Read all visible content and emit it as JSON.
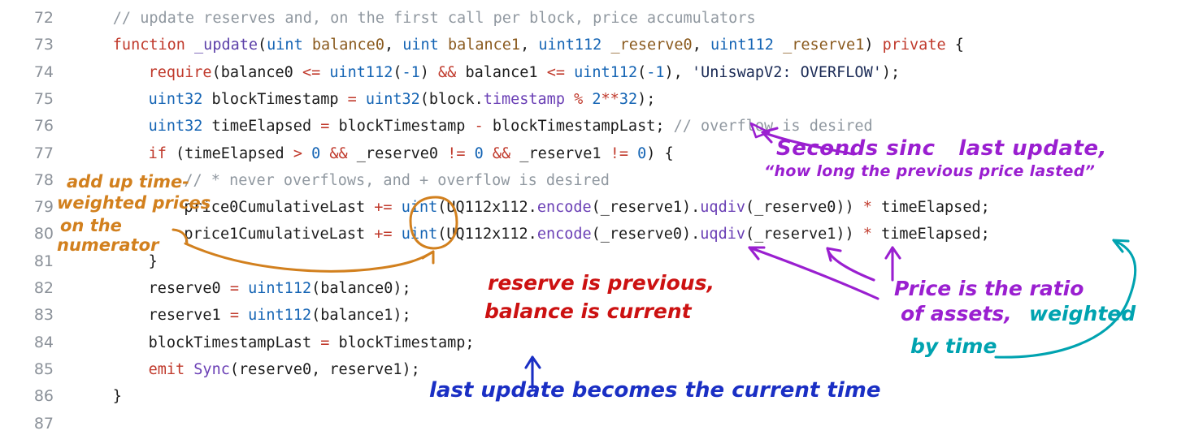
{
  "document": {
    "kind": "source-code-screenshot-with-handwritten-annotations",
    "language": "Solidity",
    "font_size_px": 18.5
  },
  "colors": {
    "background": "#ffffff",
    "line_number": "#8b9199",
    "comment": "#9098a0",
    "keyword": "#c0392b",
    "function_name": "#5b3fa8",
    "type": "#1464b4",
    "parameter": "#8a5a1e",
    "number": "#1464b4",
    "operator": "#c0392b",
    "string": "#1a2a55",
    "method": "#6a3fb5",
    "ink_purple": "#9a1fd0",
    "ink_orange": "#d2801e",
    "ink_red": "#cc1111",
    "ink_blue": "#1a2fc4",
    "ink_teal": "#00a3b0"
  },
  "code": {
    "first_line_number": 72,
    "lines": [
      {
        "n": "72",
        "indent": 4,
        "tokens": [
          {
            "t": "// update reserves and, on the first call per block, price accumulators",
            "c": "c-com"
          }
        ]
      },
      {
        "n": "73",
        "indent": 4,
        "tokens": [
          {
            "t": "function ",
            "c": "c-kw"
          },
          {
            "t": "_update",
            "c": "c-fn"
          },
          {
            "t": "(",
            "c": "c-plain"
          },
          {
            "t": "uint",
            "c": "c-type"
          },
          {
            "t": " ",
            "c": "c-plain"
          },
          {
            "t": "balance0",
            "c": "c-param"
          },
          {
            "t": ", ",
            "c": "c-plain"
          },
          {
            "t": "uint",
            "c": "c-type"
          },
          {
            "t": " ",
            "c": "c-plain"
          },
          {
            "t": "balance1",
            "c": "c-param"
          },
          {
            "t": ", ",
            "c": "c-plain"
          },
          {
            "t": "uint112",
            "c": "c-type"
          },
          {
            "t": " ",
            "c": "c-plain"
          },
          {
            "t": "_reserve0",
            "c": "c-param"
          },
          {
            "t": ", ",
            "c": "c-plain"
          },
          {
            "t": "uint112",
            "c": "c-type"
          },
          {
            "t": " ",
            "c": "c-plain"
          },
          {
            "t": "_reserve1",
            "c": "c-param"
          },
          {
            "t": ") ",
            "c": "c-plain"
          },
          {
            "t": "private",
            "c": "c-kw"
          },
          {
            "t": " {",
            "c": "c-plain"
          }
        ]
      },
      {
        "n": "74",
        "indent": 8,
        "tokens": [
          {
            "t": "require",
            "c": "c-kw"
          },
          {
            "t": "(balance0 ",
            "c": "c-plain"
          },
          {
            "t": "<=",
            "c": "c-op"
          },
          {
            "t": " ",
            "c": "c-plain"
          },
          {
            "t": "uint112",
            "c": "c-type"
          },
          {
            "t": "(",
            "c": "c-plain"
          },
          {
            "t": "-1",
            "c": "c-num"
          },
          {
            "t": ") ",
            "c": "c-plain"
          },
          {
            "t": "&&",
            "c": "c-op"
          },
          {
            "t": " balance1 ",
            "c": "c-plain"
          },
          {
            "t": "<=",
            "c": "c-op"
          },
          {
            "t": " ",
            "c": "c-plain"
          },
          {
            "t": "uint112",
            "c": "c-type"
          },
          {
            "t": "(",
            "c": "c-plain"
          },
          {
            "t": "-1",
            "c": "c-num"
          },
          {
            "t": "), ",
            "c": "c-plain"
          },
          {
            "t": "'UniswapV2: OVERFLOW'",
            "c": "c-str"
          },
          {
            "t": ");",
            "c": "c-plain"
          }
        ]
      },
      {
        "n": "75",
        "indent": 8,
        "tokens": [
          {
            "t": "uint32",
            "c": "c-type"
          },
          {
            "t": " blockTimestamp ",
            "c": "c-plain"
          },
          {
            "t": "=",
            "c": "c-op"
          },
          {
            "t": " ",
            "c": "c-plain"
          },
          {
            "t": "uint32",
            "c": "c-type"
          },
          {
            "t": "(block.",
            "c": "c-plain"
          },
          {
            "t": "timestamp",
            "c": "c-meth"
          },
          {
            "t": " ",
            "c": "c-plain"
          },
          {
            "t": "%",
            "c": "c-op"
          },
          {
            "t": " ",
            "c": "c-plain"
          },
          {
            "t": "2",
            "c": "c-num"
          },
          {
            "t": "**",
            "c": "c-op"
          },
          {
            "t": "32",
            "c": "c-num"
          },
          {
            "t": ");",
            "c": "c-plain"
          }
        ]
      },
      {
        "n": "76",
        "indent": 8,
        "tokens": [
          {
            "t": "uint32",
            "c": "c-type"
          },
          {
            "t": " timeElapsed ",
            "c": "c-plain"
          },
          {
            "t": "=",
            "c": "c-op"
          },
          {
            "t": " blockTimestamp ",
            "c": "c-plain"
          },
          {
            "t": "-",
            "c": "c-op"
          },
          {
            "t": " blockTimestampLast; ",
            "c": "c-plain"
          },
          {
            "t": "// overflow is desired",
            "c": "c-com"
          }
        ]
      },
      {
        "n": "77",
        "indent": 8,
        "tokens": [
          {
            "t": "if",
            "c": "c-kw"
          },
          {
            "t": " (timeElapsed ",
            "c": "c-plain"
          },
          {
            "t": ">",
            "c": "c-op"
          },
          {
            "t": " ",
            "c": "c-plain"
          },
          {
            "t": "0",
            "c": "c-num"
          },
          {
            "t": " ",
            "c": "c-plain"
          },
          {
            "t": "&&",
            "c": "c-op"
          },
          {
            "t": " _reserve0 ",
            "c": "c-plain"
          },
          {
            "t": "!=",
            "c": "c-op"
          },
          {
            "t": " ",
            "c": "c-plain"
          },
          {
            "t": "0",
            "c": "c-num"
          },
          {
            "t": " ",
            "c": "c-plain"
          },
          {
            "t": "&&",
            "c": "c-op"
          },
          {
            "t": " _reserve1 ",
            "c": "c-plain"
          },
          {
            "t": "!=",
            "c": "c-op"
          },
          {
            "t": " ",
            "c": "c-plain"
          },
          {
            "t": "0",
            "c": "c-num"
          },
          {
            "t": ") {",
            "c": "c-plain"
          }
        ]
      },
      {
        "n": "78",
        "indent": 12,
        "tokens": [
          {
            "t": "// * never overflows, and + overflow is desired",
            "c": "c-com"
          }
        ]
      },
      {
        "n": "79",
        "indent": 12,
        "tokens": [
          {
            "t": "price0CumulativeLast ",
            "c": "c-plain"
          },
          {
            "t": "+=",
            "c": "c-op"
          },
          {
            "t": " ",
            "c": "c-plain"
          },
          {
            "t": "uint",
            "c": "c-type"
          },
          {
            "t": "(UQ112x112.",
            "c": "c-plain"
          },
          {
            "t": "encode",
            "c": "c-meth"
          },
          {
            "t": "(_reserve1).",
            "c": "c-plain"
          },
          {
            "t": "uqdiv",
            "c": "c-meth"
          },
          {
            "t": "(_reserve0)) ",
            "c": "c-plain"
          },
          {
            "t": "*",
            "c": "c-op"
          },
          {
            "t": " timeElapsed;",
            "c": "c-plain"
          }
        ]
      },
      {
        "n": "80",
        "indent": 12,
        "tokens": [
          {
            "t": "price1CumulativeLast ",
            "c": "c-plain"
          },
          {
            "t": "+=",
            "c": "c-op"
          },
          {
            "t": " ",
            "c": "c-plain"
          },
          {
            "t": "uint",
            "c": "c-type"
          },
          {
            "t": "(UQ112x112.",
            "c": "c-plain"
          },
          {
            "t": "encode",
            "c": "c-meth"
          },
          {
            "t": "(_reserve0).",
            "c": "c-plain"
          },
          {
            "t": "uqdiv",
            "c": "c-meth"
          },
          {
            "t": "(_reserve1)) ",
            "c": "c-plain"
          },
          {
            "t": "*",
            "c": "c-op"
          },
          {
            "t": " timeElapsed;",
            "c": "c-plain"
          }
        ]
      },
      {
        "n": "81",
        "indent": 8,
        "tokens": [
          {
            "t": "}",
            "c": "c-plain"
          }
        ]
      },
      {
        "n": "82",
        "indent": 8,
        "tokens": [
          {
            "t": "reserve0 ",
            "c": "c-plain"
          },
          {
            "t": "=",
            "c": "c-op"
          },
          {
            "t": " ",
            "c": "c-plain"
          },
          {
            "t": "uint112",
            "c": "c-type"
          },
          {
            "t": "(balance0);",
            "c": "c-plain"
          }
        ]
      },
      {
        "n": "83",
        "indent": 8,
        "tokens": [
          {
            "t": "reserve1 ",
            "c": "c-plain"
          },
          {
            "t": "=",
            "c": "c-op"
          },
          {
            "t": " ",
            "c": "c-plain"
          },
          {
            "t": "uint112",
            "c": "c-type"
          },
          {
            "t": "(balance1);",
            "c": "c-plain"
          }
        ]
      },
      {
        "n": "84",
        "indent": 8,
        "tokens": [
          {
            "t": "blockTimestampLast ",
            "c": "c-plain"
          },
          {
            "t": "=",
            "c": "c-op"
          },
          {
            "t": " blockTimestamp;",
            "c": "c-plain"
          }
        ]
      },
      {
        "n": "85",
        "indent": 8,
        "tokens": [
          {
            "t": "emit",
            "c": "c-kw"
          },
          {
            "t": " ",
            "c": "c-plain"
          },
          {
            "t": "Sync",
            "c": "c-meth"
          },
          {
            "t": "(reserve0, reserve1);",
            "c": "c-plain"
          }
        ]
      },
      {
        "n": "86",
        "indent": 4,
        "tokens": [
          {
            "t": "}",
            "c": "c-plain"
          }
        ]
      },
      {
        "n": "87",
        "indent": 0,
        "tokens": [
          {
            "t": "",
            "c": "c-plain"
          }
        ]
      }
    ]
  },
  "annotations": [
    {
      "id": "seconds-since-last-update",
      "ink": "purple",
      "text": "Seconds sinc   last update,"
    },
    {
      "id": "how-long-previous-price-lasted",
      "ink": "purple",
      "text": "“how long the previous price lasted”"
    },
    {
      "id": "add-up-time-weighted-prices-line1",
      "ink": "orange",
      "text": "add up time-"
    },
    {
      "id": "add-up-time-weighted-prices-line2",
      "ink": "orange",
      "text": "weighted prices"
    },
    {
      "id": "add-up-time-weighted-prices-line3",
      "ink": "orange",
      "text": "on the"
    },
    {
      "id": "add-up-time-weighted-prices-line4",
      "ink": "orange",
      "text": "numerator"
    },
    {
      "id": "reserve-is-previous-line1",
      "ink": "red",
      "text": "reserve is previous,"
    },
    {
      "id": "reserve-is-previous-line2",
      "ink": "red",
      "text": "balance is current"
    },
    {
      "id": "price-is-ratio-line1",
      "ink": "purple",
      "text": "Price is the ratio"
    },
    {
      "id": "price-is-ratio-line2",
      "ink": "purple",
      "text": "of assets,"
    },
    {
      "id": "weighted-by-time-line1",
      "ink": "teal",
      "text": "weighted"
    },
    {
      "id": "weighted-by-time-line2",
      "ink": "teal",
      "text": "by time"
    },
    {
      "id": "last-update-becomes-current-time",
      "ink": "blue",
      "text": "last update becomes the current time"
    }
  ]
}
